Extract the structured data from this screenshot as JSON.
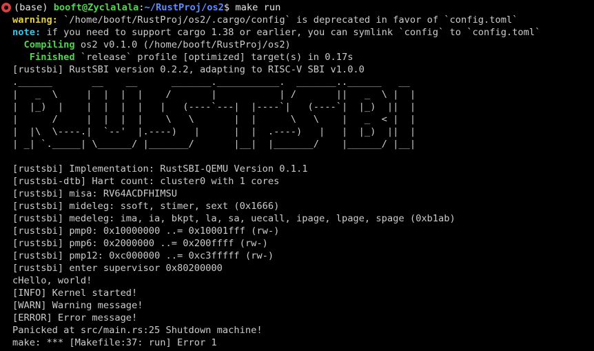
{
  "terminal": {
    "prompt": {
      "env": "(base) ",
      "user_host": "booft@Zyclalala",
      "sep": ":",
      "path": "~/RustProj/os2",
      "symbol": "$",
      "command": " make run"
    },
    "warning": {
      "label": "warning:",
      "text": " `/home/booft/RustProj/os2/.cargo/config` is deprecated in favor of `config.toml`"
    },
    "note": {
      "label": "note:",
      "text": " if you need to support cargo 1.38 or earlier, you can symlink `config` to `config.toml`"
    },
    "compiling": {
      "label": "  Compiling",
      "text": " os2 v0.1.0 (/home/booft/RustProj/os2)"
    },
    "finished": {
      "label": "   Finished",
      "text": " `release` profile [optimized] target(s) in 0.17s"
    },
    "rustsbi_version": "[rustsbi] RustSBI version 0.2.2, adapting to RISC-V SBI v1.0.0",
    "logo_art": [
      ".______       __    __      _______.___________.  _______..______   __",
      "|   _  \\     |  |  |  |    /       |           | /       ||   _  \\ |  |",
      "|  |_)  |    |  |  |  |   |   (----`---|  |----`|   (----`|  |_)  ||  |",
      "|      /     |  |  |  |    \\   \\       |  |      \\   \\    |   _  < |  |",
      "|  |\\  \\----.|  `--'  |.----)   |      |  |  .----)   |   |  |_)  ||  |",
      "| _| `._____| \\______/ |_______/       |__|  |_______/    |______/ |__|"
    ],
    "boot_lines": [
      "[rustsbi] Implementation: RustSBI-QEMU Version 0.1.1",
      "[rustsbi-dtb] Hart count: cluster0 with 1 cores",
      "[rustsbi] misa: RV64ACDFHIMSU",
      "[rustsbi] mideleg: ssoft, stimer, sext (0x1666)",
      "[rustsbi] medeleg: ima, ia, bkpt, la, sa, uecall, ipage, lpage, spage (0xb1ab)",
      "[rustsbi] pmp0: 0x10000000 ..= 0x10001fff (rw-)",
      "[rustsbi] pmp6: 0x2000000 ..= 0x200ffff (rw-)",
      "[rustsbi] pmp12: 0xc000000 ..= 0xc3fffff (rw-)",
      "[rustsbi] enter supervisor 0x80200000",
      "cHello, world!",
      "[INFO] Kernel started!",
      "[WARN] Warning message!",
      "[ERROR] Error message!",
      "Panicked at src/main.rs:25 Shutdown machine!",
      "make: *** [Makefile:37: run] Error 1"
    ]
  }
}
